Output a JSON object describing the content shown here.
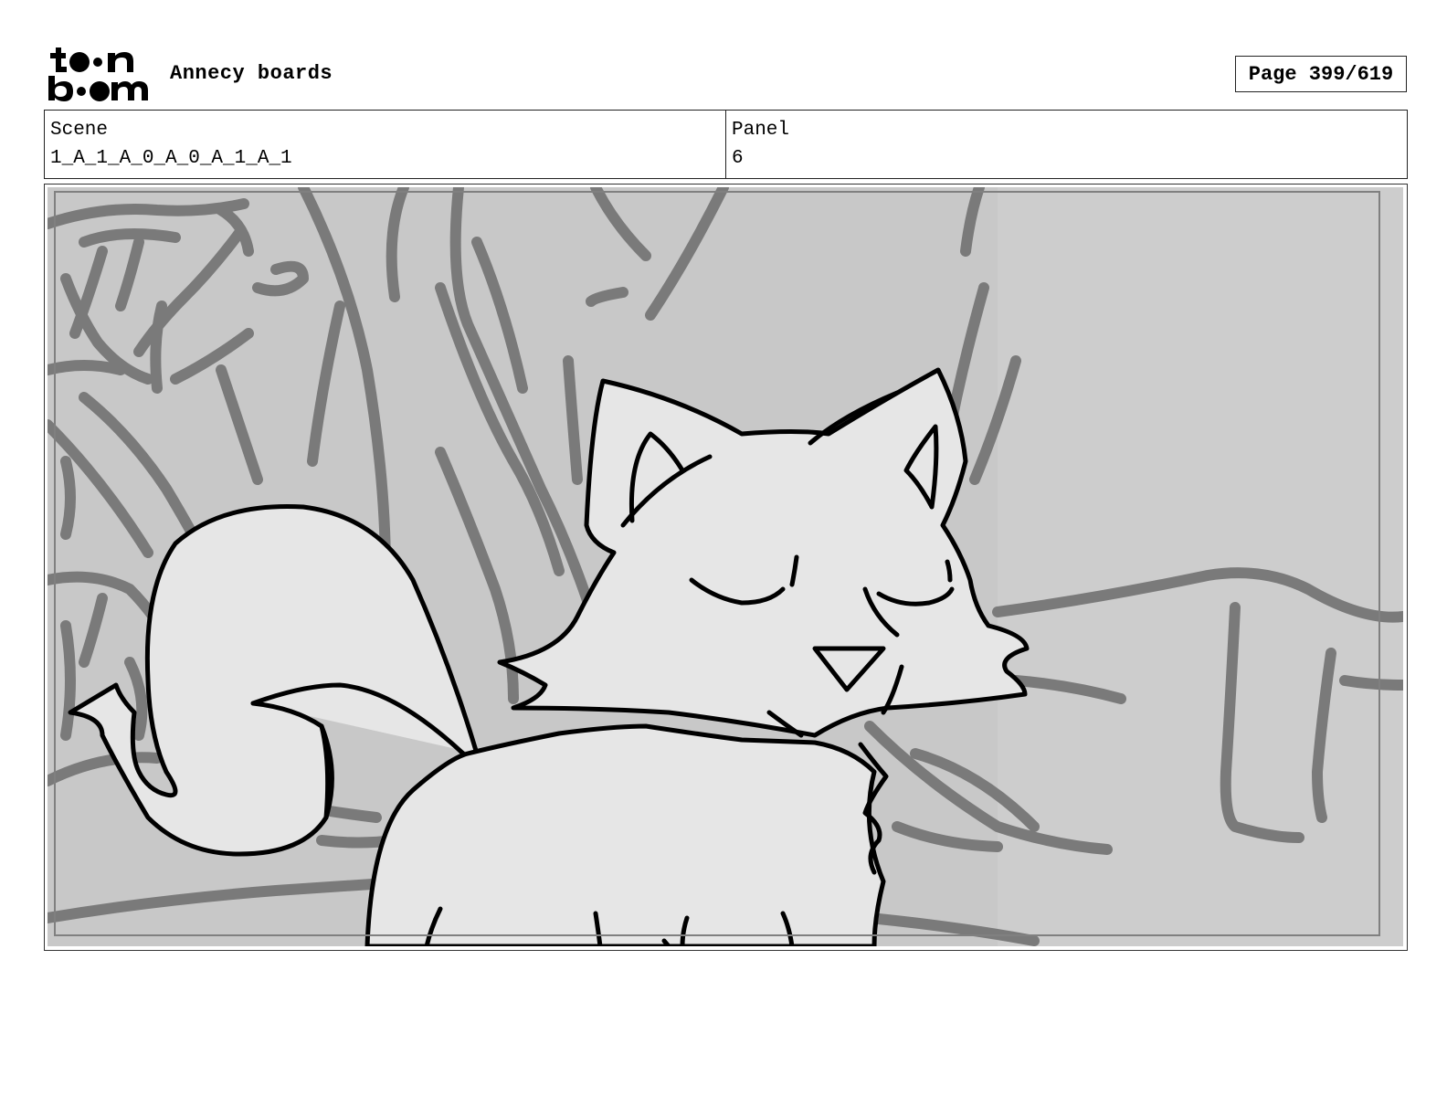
{
  "header": {
    "logo_text": "toon boom",
    "app_title": "Annecy boards",
    "page_label": "Page 399/619"
  },
  "info": {
    "scene_label": "Scene",
    "scene_value": "1_A_1_A_0_A_0_A_1_A_1",
    "panel_label": "Panel",
    "panel_value": "6"
  },
  "colors": {
    "panel_bg": "#c8c8c8",
    "sketch_gray": "#7a7a7a",
    "character_fill": "#e6e6e6",
    "ink": "#000000"
  }
}
